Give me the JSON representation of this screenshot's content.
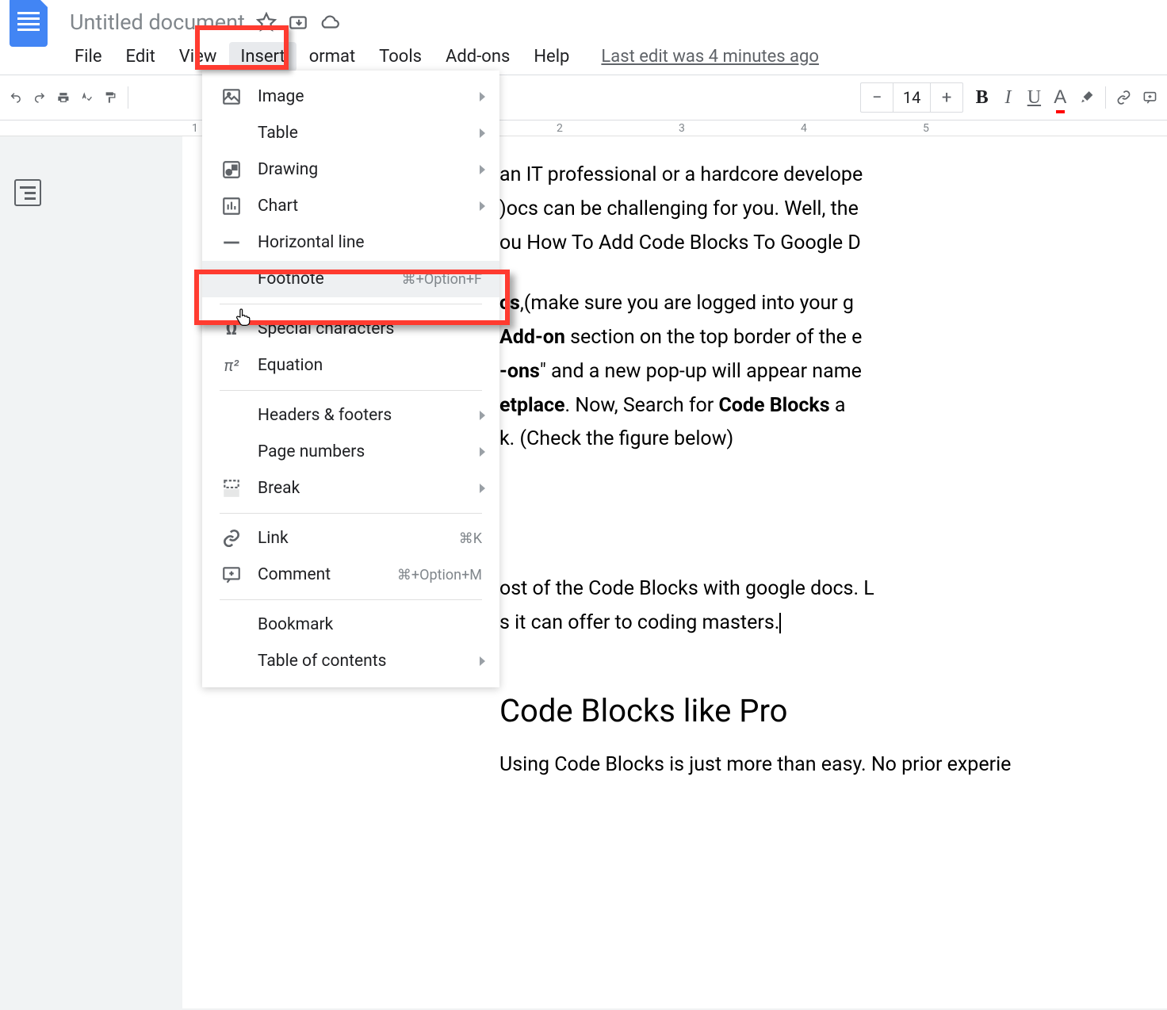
{
  "doc_title": "Untitled document",
  "menubar": {
    "file": "File",
    "edit": "Edit",
    "view": "View",
    "insert": "Insert",
    "format": "ormat",
    "tools": "Tools",
    "addons": "Add-ons",
    "help": "Help"
  },
  "last_edit": "Last edit was 4 minutes ago",
  "toolbar": {
    "font_size": "14",
    "minus": "−",
    "plus": "+",
    "bold": "B",
    "italic": "I",
    "underline": "U",
    "textcolor": "A"
  },
  "dropdown": {
    "image": "Image",
    "table": "Table",
    "drawing": "Drawing",
    "chart": "Chart",
    "hline": "Horizontal line",
    "footnote": "Footnote",
    "footnote_sc": "⌘+Option+F",
    "special": "Special characters",
    "equation": "Equation",
    "headers": "Headers & footers",
    "pagenum": "Page numbers",
    "break": "Break",
    "link": "Link",
    "link_sc": "⌘K",
    "comment": "Comment",
    "comment_sc": "⌘+Option+M",
    "bookmark": "Bookmark",
    "toc": "Table of contents"
  },
  "ruler": {
    "m1": "1",
    "m2": "2",
    "m3": "3",
    "m4": "4",
    "m5": "5"
  },
  "doc": {
    "p1a": "an IT professional or a hardcore develope",
    "p1b": ")ocs can be challenging for you. Well, the",
    "p1c": "ou How To Add Code Blocks To Google D",
    "p2a_pre": "cs",
    "p2a_post": ",(make sure you are logged into your g",
    "p2b_pre": "Add-on",
    "p2b_post": " section on the top border of the e",
    "p2c_pre": "-ons",
    "p2c_post": "\" and a new pop-up will appear name",
    "p2d_pre": "etplace",
    "p2d_mid": ". Now, Search for ",
    "p2d_bold": "Code Blocks",
    "p2d_post": " a",
    "p2e": "k. (Check the figure below)",
    "p3a": "ost of the Code Blocks with google docs. L",
    "p3b": "s it can offer to coding masters.",
    "heading": "Code Blocks like Pro",
    "p4": "Using Code Blocks is just more than easy. No prior experie"
  }
}
